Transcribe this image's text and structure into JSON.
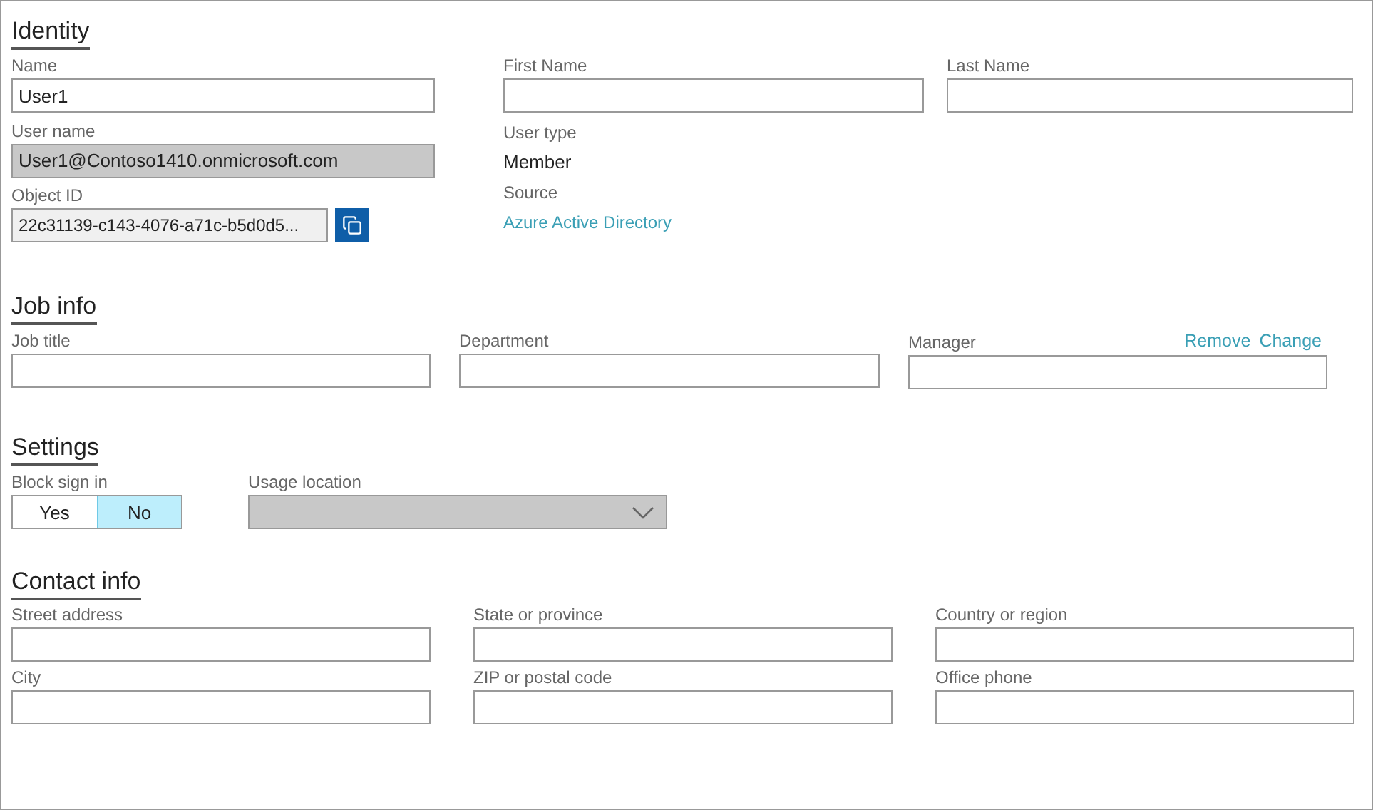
{
  "identity": {
    "title": "Identity",
    "name": {
      "label": "Name",
      "value": "User1"
    },
    "first_name": {
      "label": "First Name"
    },
    "last_name": {
      "label": "Last Name"
    },
    "user_name": {
      "label": "User name",
      "value": "User1@Contoso1410.onmicrosoft.com",
      "disabled": true
    },
    "user_type": {
      "label": "User type",
      "value": "Member"
    },
    "object_id": {
      "label": "Object ID",
      "value": "22c31139-c143-4076-a71c-b5d0d5..."
    },
    "source": {
      "label": "Source",
      "link": "Azure Active Directory"
    }
  },
  "job_info": {
    "title": "Job info",
    "fields": [
      {
        "label": "Job title"
      },
      {
        "label": "Department"
      },
      {
        "label": "Manager",
        "actions": [
          "Remove",
          "Change"
        ]
      }
    ]
  },
  "settings": {
    "title": "Settings",
    "block_sign_in": {
      "label": "Block sign in",
      "options": [
        {
          "label": "Yes",
          "selected": false
        },
        {
          "label": "No",
          "selected": true
        }
      ]
    },
    "usage_location": {
      "label": "Usage location",
      "disabled": true
    }
  },
  "contact_info": {
    "title": "Contact info",
    "rows": [
      [
        {
          "label": "Street address"
        },
        {
          "label": "State or province"
        },
        {
          "label": "Country or region"
        }
      ],
      [
        {
          "label": "City"
        },
        {
          "label": "ZIP or postal code"
        },
        {
          "label": "Office phone"
        }
      ]
    ]
  }
}
